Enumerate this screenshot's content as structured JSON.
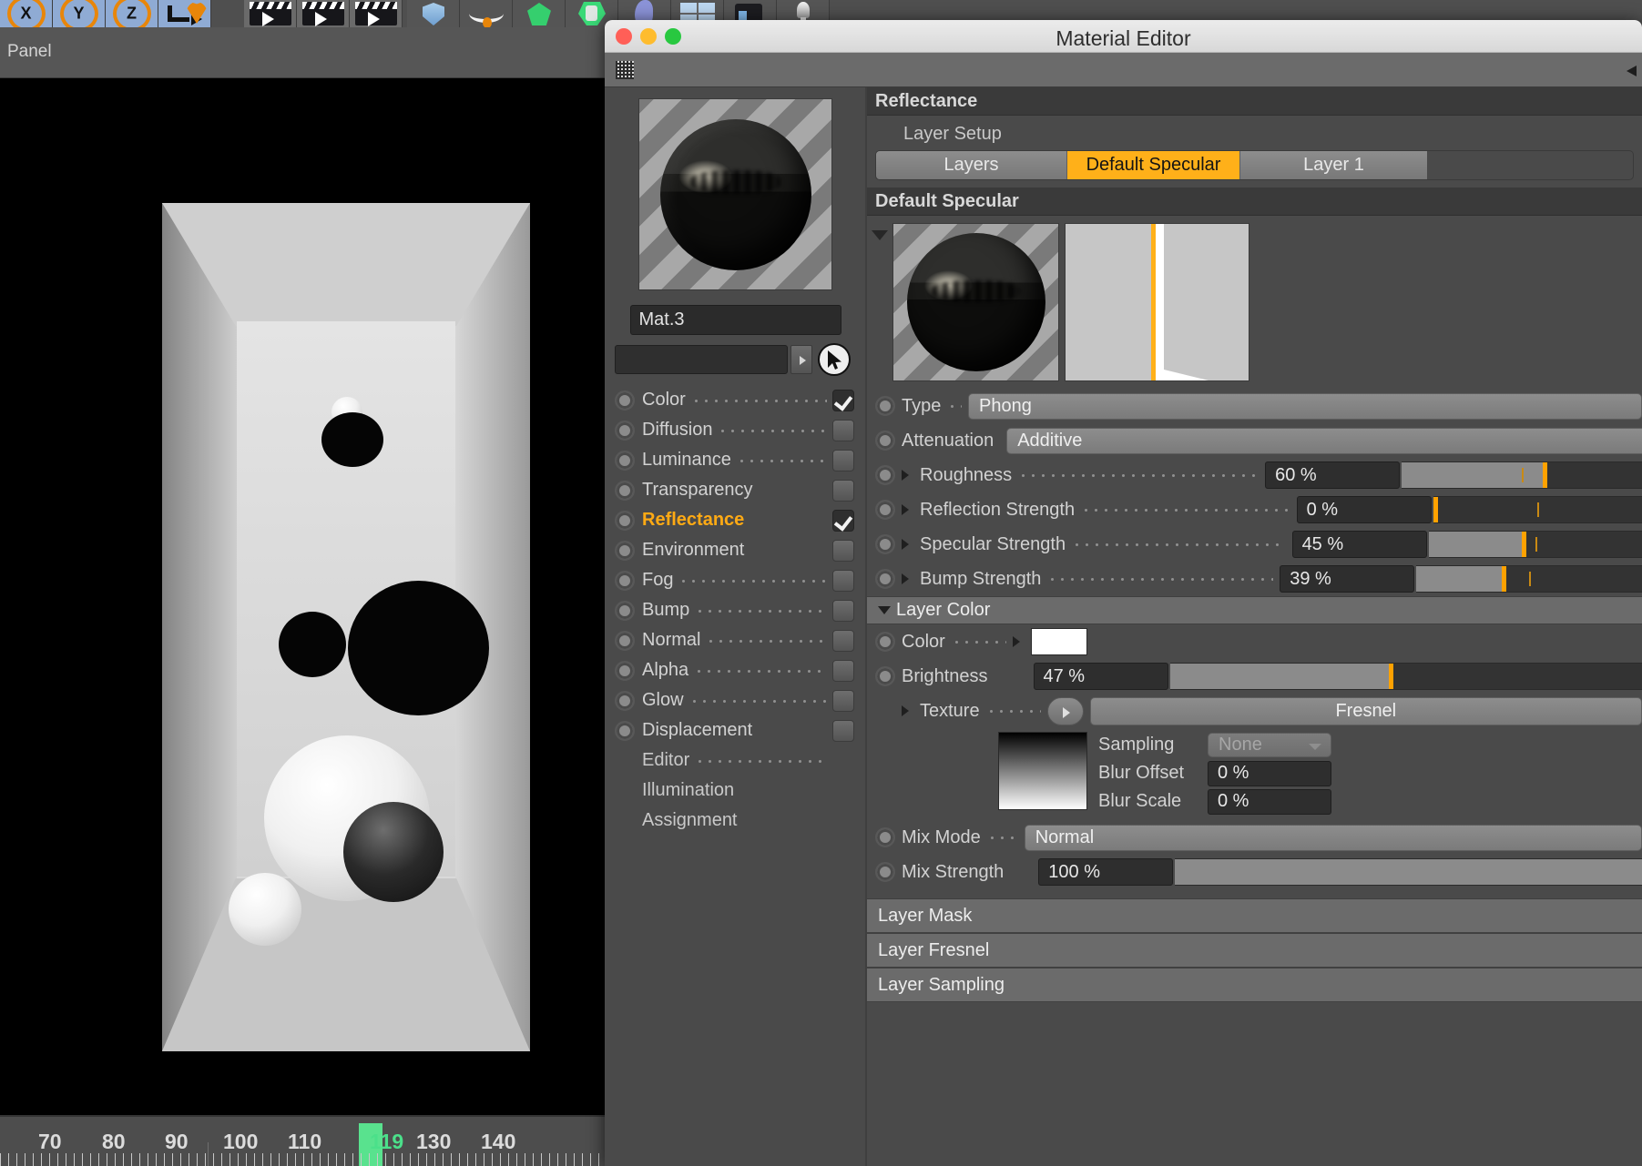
{
  "app": {
    "panel_menu_label": "Panel",
    "toolbar_icons": [
      "axis-x-icon",
      "axis-y-icon",
      "axis-z-icon",
      "move-arrow-icon",
      "play-start-icon",
      "play-forward-icon",
      "play-end-icon",
      "shield-icon",
      "necklace-icon",
      "gem-icon",
      "gem-cluster-icon",
      "spline-icon",
      "window-icon",
      "camera-icon",
      "light-bulb-icon"
    ]
  },
  "timeline": {
    "ticks": [
      "70",
      "80",
      "90",
      "100",
      "110",
      "130",
      "140"
    ],
    "current_frame": "119",
    "marker_color": "#59e28e"
  },
  "window": {
    "title": "Material Editor",
    "traffic_lights": [
      "close-button",
      "minimize-button",
      "zoom-button"
    ]
  },
  "material": {
    "name": "Mat.3",
    "search_value": "",
    "preview_name": "material-preview-sphere"
  },
  "channels": [
    {
      "label": "Color",
      "checked": true,
      "active": false,
      "dots": true
    },
    {
      "label": "Diffusion",
      "checked": false,
      "active": false,
      "dots": true
    },
    {
      "label": "Luminance",
      "checked": false,
      "active": false,
      "dots": true
    },
    {
      "label": "Transparency",
      "checked": false,
      "active": false,
      "dots": false
    },
    {
      "label": "Reflectance",
      "checked": true,
      "active": true,
      "dots": false
    },
    {
      "label": "Environment",
      "checked": false,
      "active": false,
      "dots": false
    },
    {
      "label": "Fog",
      "checked": false,
      "active": false,
      "dots": true
    },
    {
      "label": "Bump",
      "checked": false,
      "active": false,
      "dots": true
    },
    {
      "label": "Normal",
      "checked": false,
      "active": false,
      "dots": true
    },
    {
      "label": "Alpha",
      "checked": false,
      "active": false,
      "dots": true
    },
    {
      "label": "Glow",
      "checked": false,
      "active": false,
      "dots": true
    },
    {
      "label": "Displacement",
      "checked": false,
      "active": false,
      "dots": false
    }
  ],
  "channels_plain": [
    {
      "label": "Editor",
      "dots": true
    },
    {
      "label": "Illumination",
      "dots": false
    },
    {
      "label": "Assignment",
      "dots": false
    }
  ],
  "reflectance": {
    "section_title": "Reflectance",
    "layer_setup_label": "Layer Setup",
    "tabs": [
      {
        "label": "Layers",
        "selected": false
      },
      {
        "label": "Default Specular",
        "selected": true
      },
      {
        "label": "Layer 1",
        "selected": false
      }
    ],
    "default_specular_title": "Default Specular",
    "params": [
      {
        "label": "Type",
        "kind": "combo",
        "value": "Phong",
        "expandable": false
      },
      {
        "label": "Attenuation",
        "kind": "combo",
        "value": "Additive",
        "expandable": false
      },
      {
        "label": "Roughness",
        "kind": "slider",
        "value": "60 %",
        "pct": 60,
        "expandable": true
      },
      {
        "label": "Reflection Strength",
        "kind": "slider",
        "value": "0 %",
        "pct": 0,
        "expandable": true
      },
      {
        "label": "Specular Strength",
        "kind": "slider",
        "value": "45 %",
        "pct": 45,
        "expandable": true
      },
      {
        "label": "Bump Strength",
        "kind": "slider",
        "value": "39 %",
        "pct": 39,
        "expandable": true
      }
    ]
  },
  "layer_color": {
    "title": "Layer Color",
    "color_label": "Color",
    "color_value": "#ffffff",
    "brightness_label": "Brightness",
    "brightness_value": "47 %",
    "brightness_pct": 47,
    "texture_label": "Texture",
    "texture_value": "Fresnel",
    "sampling_label": "Sampling",
    "sampling_value": "None",
    "blur_offset_label": "Blur Offset",
    "blur_offset_value": "0 %",
    "blur_scale_label": "Blur Scale",
    "blur_scale_value": "0 %",
    "mix_mode_label": "Mix Mode",
    "mix_mode_value": "Normal",
    "mix_strength_label": "Mix Strength",
    "mix_strength_value": "100 %",
    "mix_strength_pct": 100
  },
  "collapsed_sections": [
    {
      "label": "Layer Mask"
    },
    {
      "label": "Layer Fresnel"
    },
    {
      "label": "Layer Sampling"
    }
  ],
  "colors": {
    "accent_orange": "#ffb019",
    "slider_orange": "#ffa200",
    "panel_bg": "#4a4a4a",
    "header_bg": "#3a3a3a",
    "text": "#d2d2d2",
    "timeline_green": "#4be08a"
  }
}
